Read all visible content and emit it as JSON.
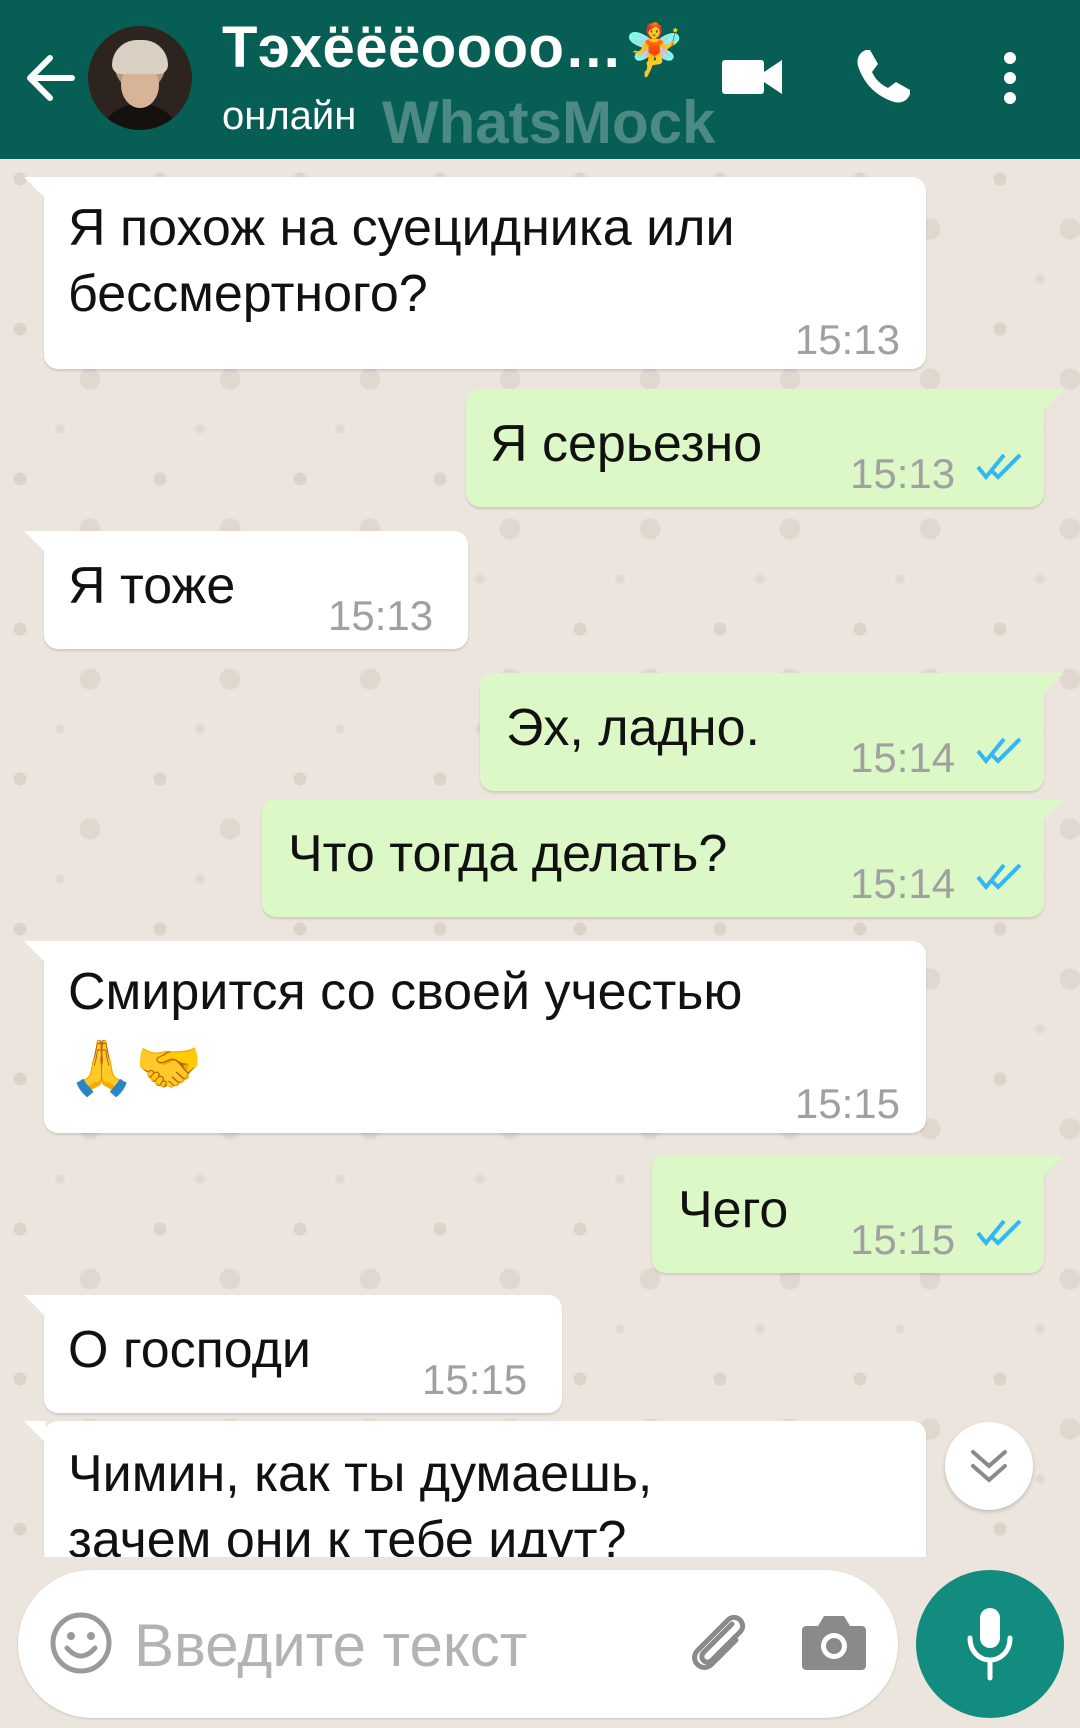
{
  "header": {
    "contact_name": "Тэхёёёоооо…",
    "contact_emoji": "🧚",
    "status": "онлайн",
    "watermark": "WhatsMock"
  },
  "colors": {
    "header_bg": "#075e54",
    "incoming_bubble": "#ffffff",
    "outgoing_bubble": "#dcf8c6",
    "read_ticks": "#34b7f1",
    "mic_button": "#128c7e",
    "chat_bg": "#ece5dd"
  },
  "messages": [
    {
      "direction": "in",
      "lines": [
        "Я похож на суецидника или",
        "бессмертного?"
      ],
      "time": "15:13"
    },
    {
      "direction": "out",
      "lines": [
        "Я серьезно"
      ],
      "time": "15:13",
      "read": true
    },
    {
      "direction": "in",
      "lines": [
        "Я тоже"
      ],
      "time": "15:13"
    },
    {
      "direction": "out",
      "lines": [
        "Эх, ладно."
      ],
      "time": "15:14",
      "read": true
    },
    {
      "direction": "out",
      "lines": [
        "Что тогда делать?"
      ],
      "time": "15:14",
      "read": true
    },
    {
      "direction": "in",
      "lines": [
        "Смирится со своей учестью",
        "🙏🤝"
      ],
      "time": "15:15"
    },
    {
      "direction": "out",
      "lines": [
        "Чего"
      ],
      "time": "15:15",
      "read": true
    },
    {
      "direction": "in",
      "lines": [
        "О господи"
      ],
      "time": "15:15"
    },
    {
      "direction": "in",
      "lines": [
        "Чимин, как ты думаешь,",
        "зачем они к тебе идут?"
      ],
      "time": ""
    }
  ],
  "input": {
    "placeholder": "Введите текст"
  },
  "icons": {
    "back": "arrow-left-icon",
    "video": "video-camera-icon",
    "call": "phone-icon",
    "menu": "more-vertical-icon",
    "emoji": "smile-icon",
    "attach": "paperclip-icon",
    "camera": "camera-icon",
    "mic": "microphone-icon",
    "scroll": "chevron-double-down-icon"
  }
}
